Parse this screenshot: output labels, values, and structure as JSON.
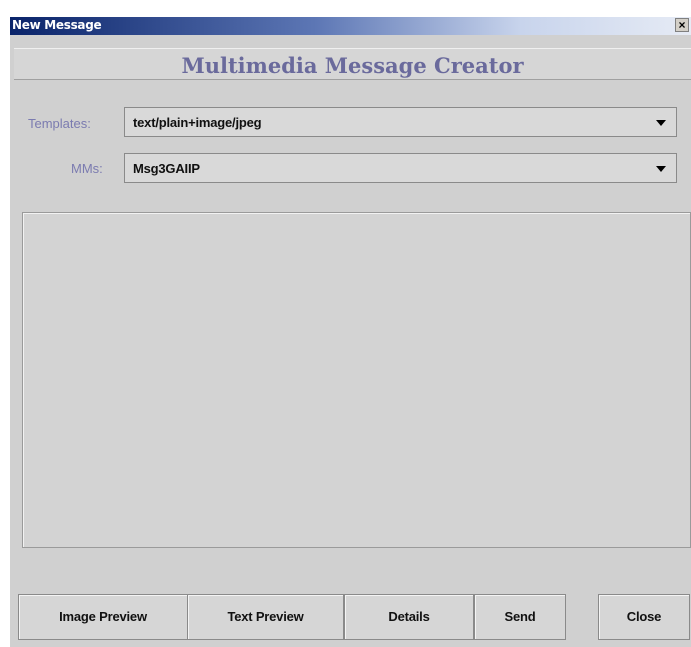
{
  "window": {
    "title": "New Message",
    "close_glyph": "×"
  },
  "header": {
    "title": "Multimedia Message Creator"
  },
  "form": {
    "templates_label": "Templates:",
    "templates_value": "text/plain+image/jpeg",
    "mms_label": "MMs:",
    "mms_value": "Msg3GAIIP"
  },
  "buttons": {
    "image_preview": "Image Preview",
    "text_preview": "Text Preview",
    "details": "Details",
    "send": "Send",
    "close": "Close"
  },
  "colors": {
    "title_bar_start": "#0a246a",
    "window_bg": "#d0d0d0",
    "label_color": "#7b7bb0",
    "heading_color": "#6a6a9c"
  }
}
